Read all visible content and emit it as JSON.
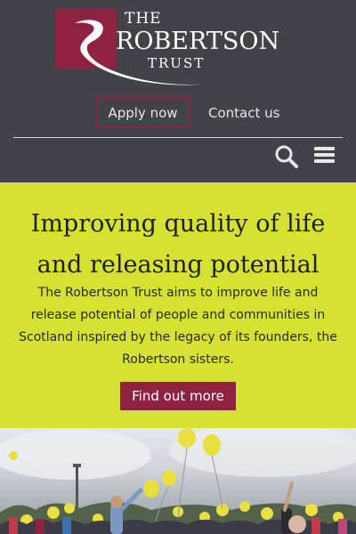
{
  "logo": {
    "the": "THE",
    "name": "ROBERTSON",
    "trust": "TRUST"
  },
  "nav": {
    "apply_label": "Apply now",
    "contact_label": "Contact us"
  },
  "icons": {
    "search": "search-icon",
    "menu": "hamburger-menu-icon"
  },
  "hero": {
    "title": "Improving quality of life and releasing potential",
    "body": "The Robertson Trust aims to improve life and release potential of people and communities in Scotland inspired by the legacy of its founders, the Robertson sisters.",
    "button_label": "Find out more"
  },
  "colors": {
    "header_bg": "#434249",
    "brand": "#8f2141",
    "hero_bg": "#d5e231"
  }
}
